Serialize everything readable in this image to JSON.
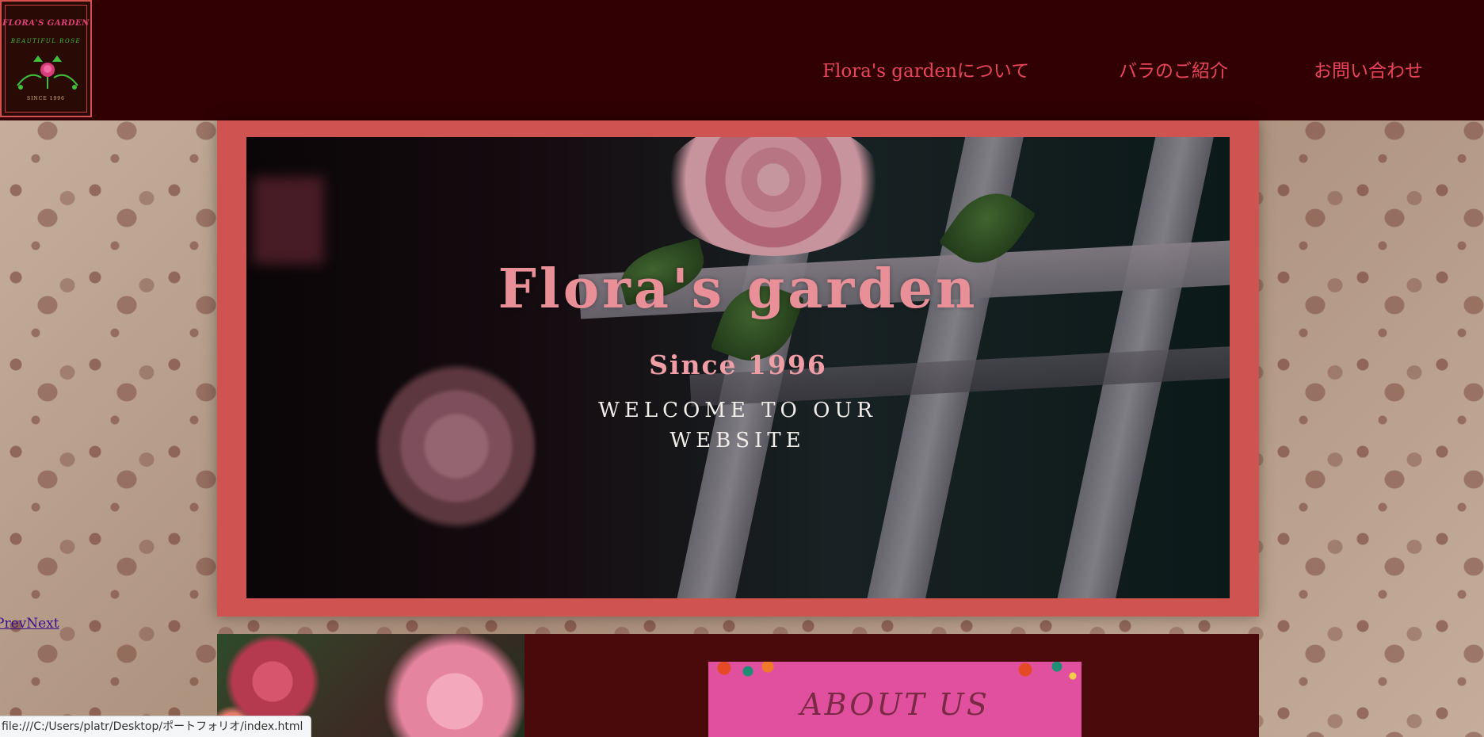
{
  "header": {
    "logo": {
      "title": "FLORA'S GARDEN",
      "subtitle": "BEAUTIFUL ROSE",
      "since": "SINCE 1996"
    },
    "nav": [
      {
        "label": "Flora's gardenについて"
      },
      {
        "label": "バラのご紹介"
      },
      {
        "label": "お問い合わせ"
      }
    ]
  },
  "hero": {
    "title": "Flora's garden",
    "since": "Since 1996",
    "welcome": "WELCOME TO OUR WEBSITE"
  },
  "slider": {
    "prev_label": "Prev",
    "next_label": "Next"
  },
  "about": {
    "banner_title": "ABOUT US"
  },
  "status_bar": {
    "url": "file:///C:/Users/platr/Desktop/ポートフォリオ/index.html"
  },
  "colors": {
    "header_bg": "#300003",
    "nav_text": "#e8455a",
    "hero_frame": "#cf5351",
    "lower_bg": "#4a090b",
    "about_banner": "#e1509f"
  }
}
